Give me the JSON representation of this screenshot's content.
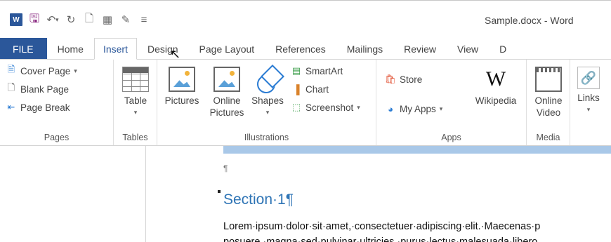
{
  "window": {
    "title": "Sample.docx - Word"
  },
  "qat": {
    "icons": [
      "word-logo-icon",
      "save-icon",
      "undo-icon",
      "redo-icon",
      "new-doc-icon",
      "print-preview-icon",
      "touch-mode-icon",
      "customize-icon"
    ],
    "logo_text": "W"
  },
  "tabs": [
    "FILE",
    "Home",
    "Insert",
    "Design",
    "Page Layout",
    "References",
    "Mailings",
    "Review",
    "View",
    "D"
  ],
  "active_tab": "Insert",
  "ribbon": {
    "pages": {
      "label": "Pages",
      "cover_page": "Cover Page",
      "blank_page": "Blank Page",
      "page_break": "Page Break"
    },
    "tables": {
      "label": "Tables",
      "table": "Table"
    },
    "illustrations": {
      "label": "Illustrations",
      "pictures": "Pictures",
      "online_pictures_1": "Online",
      "online_pictures_2": "Pictures",
      "shapes": "Shapes",
      "smartart": "SmartArt",
      "chart": "Chart",
      "screenshot": "Screenshot"
    },
    "apps": {
      "label": "Apps",
      "store": "Store",
      "my_apps": "My Apps",
      "wikipedia": "Wikipedia",
      "wikipedia_glyph": "W"
    },
    "media": {
      "label": "Media",
      "online_video_1": "Online",
      "online_video_2": "Video"
    },
    "links": {
      "label": "Links"
    }
  },
  "document": {
    "pilcrow": "¶",
    "heading": "Section·1¶",
    "line1": "Lorem·ipsum·dolor·sit·amet,·consectetuer·adipiscing·elit.·Maecenas·p",
    "line2": "posuere,·magna·sed·pulvinar·ultricies,·purus·lectus·malesuada·libero,"
  },
  "colors": {
    "accent": "#2b579a",
    "heading": "#2e74b5",
    "ruler": "#a9c8e8"
  }
}
